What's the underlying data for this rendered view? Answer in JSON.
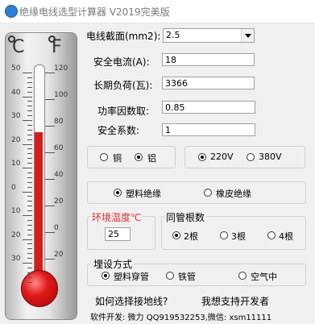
{
  "window": {
    "title": "绝缘电线选型计算器 V2019完美版"
  },
  "thermometer": {
    "celsius_unit": "C",
    "fahrenheit_unit": "F",
    "celsius_ticks": [
      "50",
      "40",
      "30",
      "20",
      "10",
      "0",
      "10",
      "20",
      "30"
    ],
    "fahrenheit_ticks": [
      "120",
      "100",
      "80",
      "60",
      "40",
      "20",
      "0",
      "20"
    ],
    "reading_celsius": 25
  },
  "form": {
    "cross_section": {
      "label": "电线截面(mm2):",
      "value": "2.5"
    },
    "safe_current": {
      "label": "安全电流(A):",
      "value": "18"
    },
    "long_load": {
      "label": "长期负荷(瓦):",
      "value": "3366"
    },
    "power_factor": {
      "label": "功率因数取:",
      "value": "0.85"
    },
    "safety_factor": {
      "label": "安全系数:",
      "value": "1"
    }
  },
  "material": {
    "options": [
      "铜",
      "铝"
    ],
    "selected": "铝"
  },
  "voltage": {
    "options": [
      "220V",
      "380V"
    ],
    "selected": "220V"
  },
  "insulation": {
    "options": [
      "塑料绝缘",
      "橡皮绝缘"
    ],
    "selected": "塑料绝缘"
  },
  "ambient": {
    "label": "环境温度℃",
    "value": "25",
    "label_color": "#e03030"
  },
  "conduit_count": {
    "label": "同管根数",
    "options": [
      "2根",
      "3根",
      "4根"
    ],
    "selected": "2根"
  },
  "laying": {
    "label": "埋设方式",
    "options": [
      "塑料穿管",
      "铁管",
      "空气中"
    ],
    "selected": "塑料穿管"
  },
  "links": {
    "ground_wire": "如何选择接地线?",
    "support": "我想支持开发者"
  },
  "footer": "软件开发: 微力 QQ919532253,微信: xsm11111"
}
